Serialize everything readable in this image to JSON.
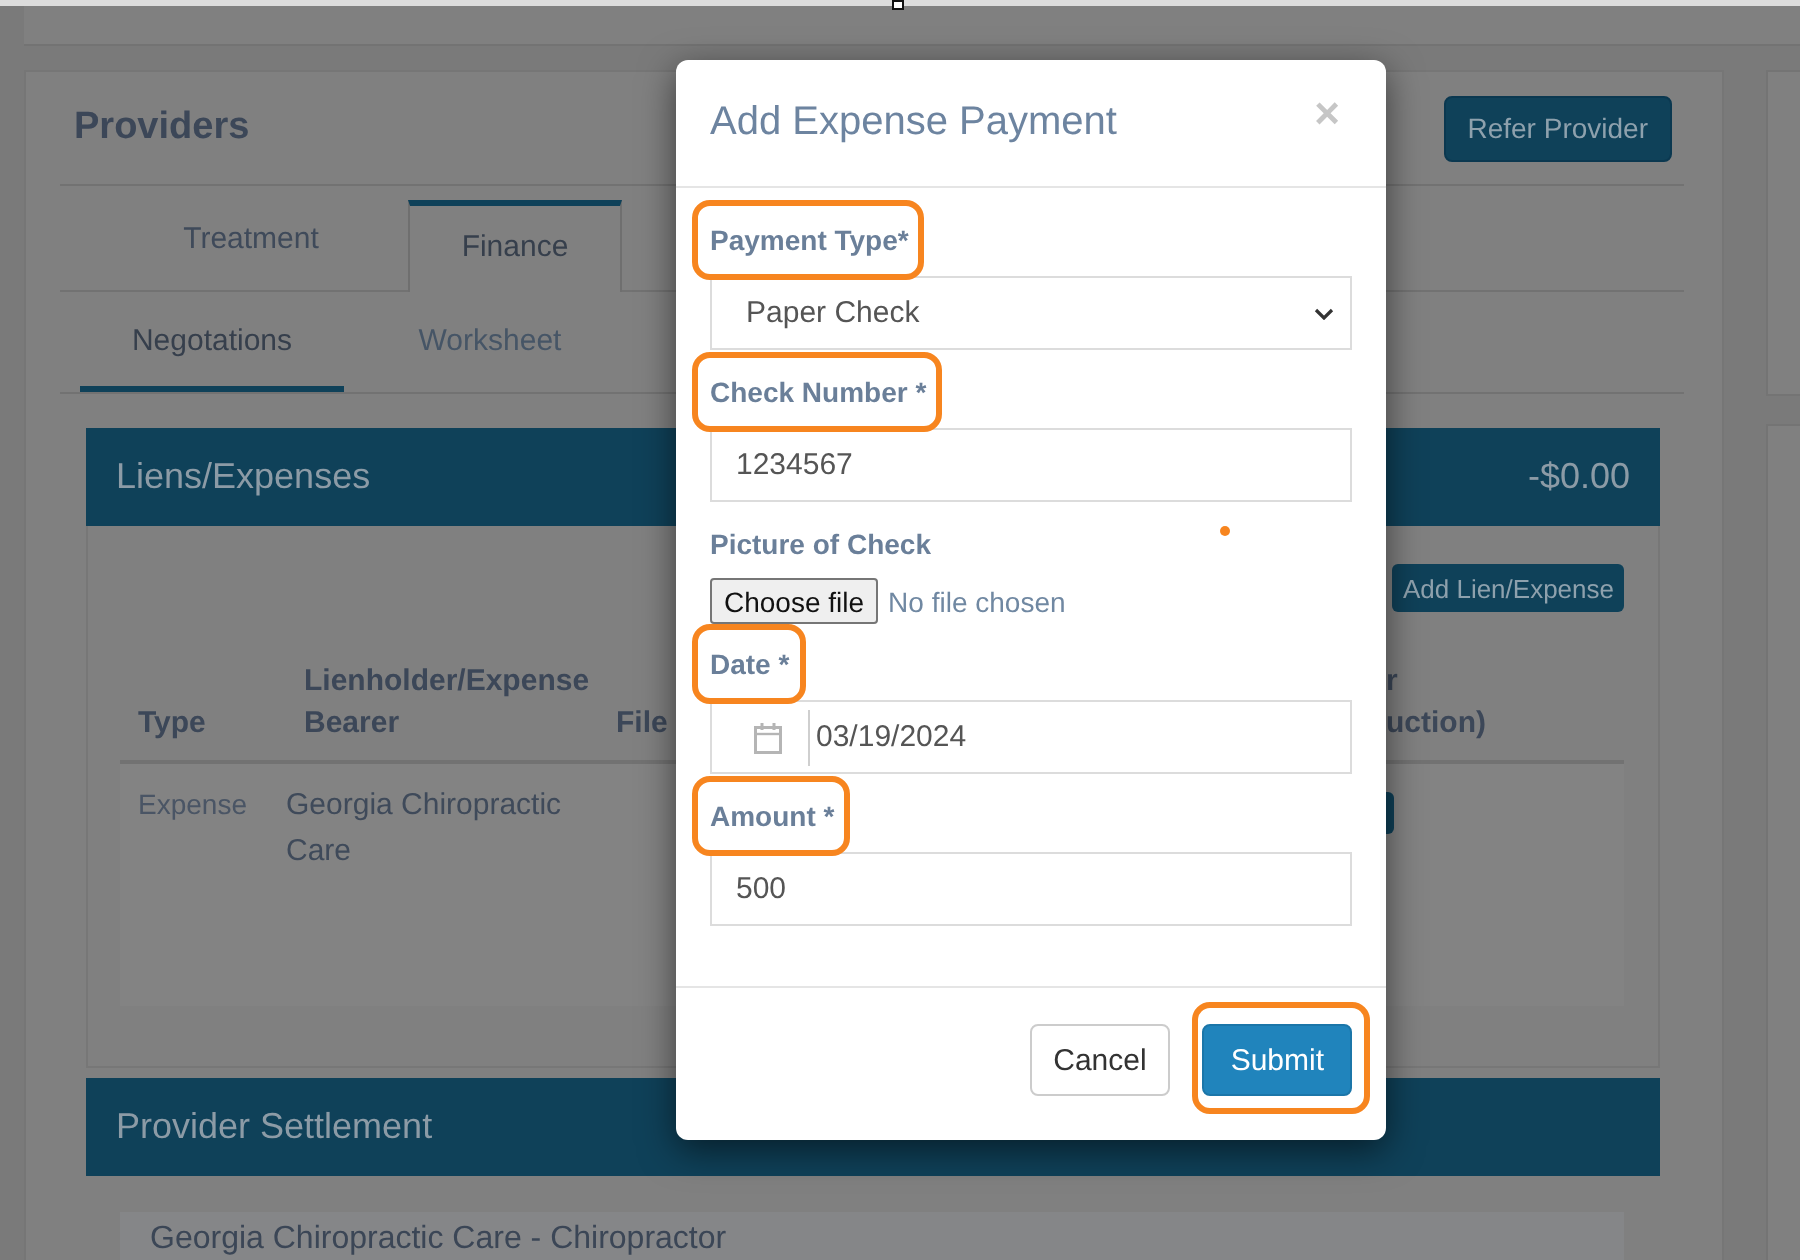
{
  "page": {
    "title": "Providers",
    "refer_button": "Refer Provider",
    "tabs": [
      {
        "label": "Treatment",
        "selected": false
      },
      {
        "label": "Finance",
        "selected": true
      }
    ],
    "subtabs": [
      {
        "label": "Negotations",
        "selected": true
      },
      {
        "label": "Worksheet",
        "selected": false
      }
    ],
    "liens": {
      "title": "Liens/Expenses",
      "total": "-$0.00",
      "add_button": "Add Lien/Expense",
      "columns": [
        "Type",
        "Lienholder/Expense Bearer",
        "File"
      ],
      "column_4_lines": [
        "r",
        "uction)"
      ],
      "rows": [
        {
          "type": "Expense",
          "bearer": "Georgia Chiropractic Care"
        }
      ]
    },
    "settlement": {
      "title": "Provider Settlement",
      "entries": [
        "Georgia Chiropractic Care - Chiropractor"
      ]
    }
  },
  "modal": {
    "title": "Add Expense Payment",
    "close": "×",
    "fields": [
      {
        "kind": "select",
        "label": "Payment Type*",
        "value": "Paper Check",
        "highlighted": true
      },
      {
        "kind": "text",
        "label": "Check Number *",
        "value": "1234567",
        "highlighted": true
      },
      {
        "kind": "file",
        "label": "Picture of Check",
        "button": "Choose file",
        "status": "No file chosen",
        "highlighted": false
      },
      {
        "kind": "date",
        "label": "Date *",
        "value": "03/19/2024",
        "highlighted": true
      },
      {
        "kind": "text",
        "label": "Amount *",
        "value": "500",
        "highlighted": true
      }
    ],
    "buttons": [
      {
        "kind": "secondary",
        "label": "Cancel",
        "highlighted": false
      },
      {
        "kind": "primary",
        "label": "Submit",
        "highlighted": true
      }
    ]
  }
}
